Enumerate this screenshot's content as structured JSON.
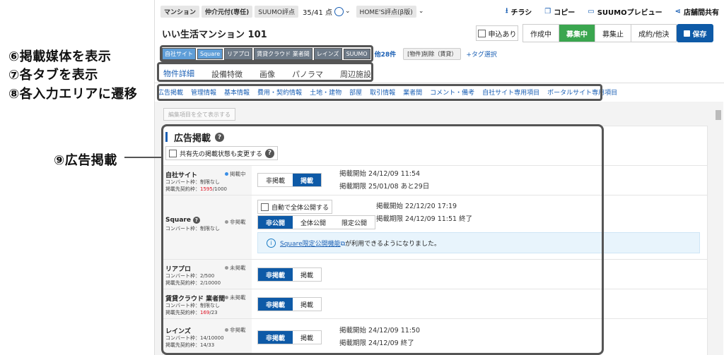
{
  "annotations": {
    "a6": "⑥掲載媒体を表示",
    "a7": "⑦各タブを表示",
    "a8": "⑧各入力エリアに遷移",
    "a9": "⑨広告掲載"
  },
  "header": {
    "tags": [
      "マンション",
      "仲介元付(専任)",
      "SUUMO評点"
    ],
    "score": "35/41 点",
    "homes": "HOME'S評点(β版)",
    "actions": {
      "flyer": "チラシ",
      "copy": "コピー",
      "preview": "SUUMOプレビュー",
      "share": "店舗間共有"
    }
  },
  "property": {
    "title": "いい生活マンション 101",
    "apply": "申込あり",
    "status": [
      "作成中",
      "募集中",
      "募集止",
      "成約/他決"
    ],
    "active_status": "募集中",
    "save": "保存"
  },
  "media_bar": {
    "chips": [
      "自社サイト",
      "Square",
      "リアプロ",
      "賃貸クラウド 業者間",
      "レインズ",
      "SUUMO"
    ],
    "more": "他28件",
    "tag": "[物件]削除（賃貸）",
    "add_tag": "+タグ選択"
  },
  "tabs": [
    "物件詳細",
    "設備特徴",
    "画像",
    "パノラマ",
    "周辺施設"
  ],
  "anchors": [
    "広告掲載",
    "管理情報",
    "基本情報",
    "費用・契約情報",
    "土地・建物",
    "部屋",
    "取引情報",
    "業者間",
    "コメント・備考",
    "自社サイト専用項目",
    "ポータルサイト専用項目"
  ],
  "show_all": "編集項目を全て表示する",
  "ad_section": {
    "title": "広告掲載",
    "share_change": "共有先の掲載状態も変更する",
    "rows": [
      {
        "name": "自社サイト",
        "info1": "コンバート枠：制限なし",
        "info2_a": "掲載先契約枠：",
        "info2_red": "1595",
        "info2_b": "/1000",
        "state": "掲載中",
        "state_color": "#3a8ee6",
        "opt_off": "非掲載",
        "opt_on": "掲載",
        "start": "掲載開始 24/12/09 11:54",
        "end": "掲載期限 25/01/08 あと29日"
      },
      {
        "name": "Square",
        "info1": "コンバート枠：制限なし",
        "state": "非掲載",
        "state_color": "#999",
        "auto": "自動で全体公開する",
        "opts": [
          "非公開",
          "全体公開",
          "限定公開"
        ],
        "start": "掲載開始 22/12/20 17:19",
        "end": "掲載期限 24/12/09 11:51 終了",
        "notice_link": "Square限定公開機能",
        "notice_rest": "が利用できるようになりました。"
      },
      {
        "name": "リアプロ",
        "info1": "コンバート枠：2/500",
        "info2": "掲載先契約枠：2/10000",
        "state": "未掲載",
        "state_color": "#999",
        "opt_off": "非掲載",
        "opt_on": "掲載"
      },
      {
        "name": "賃貸クラウド 業者間",
        "info1": "コンバート枠：制限なし",
        "info2_a": "掲載先契約枠：",
        "info2_red": "169",
        "info2_b": "/23",
        "state": "未掲載",
        "state_color": "#999",
        "opt_off": "非掲載",
        "opt_on": "掲載"
      },
      {
        "name": "レインズ",
        "info1": "コンバート枠：14/10000",
        "info2": "掲載先契約枠：14/33",
        "state": "非掲載",
        "state_color": "#999",
        "opt_off": "非掲載",
        "opt_on": "掲載",
        "start": "掲載開始 24/12/09 11:50",
        "end": "掲載期限 24/12/09 終了"
      }
    ]
  }
}
